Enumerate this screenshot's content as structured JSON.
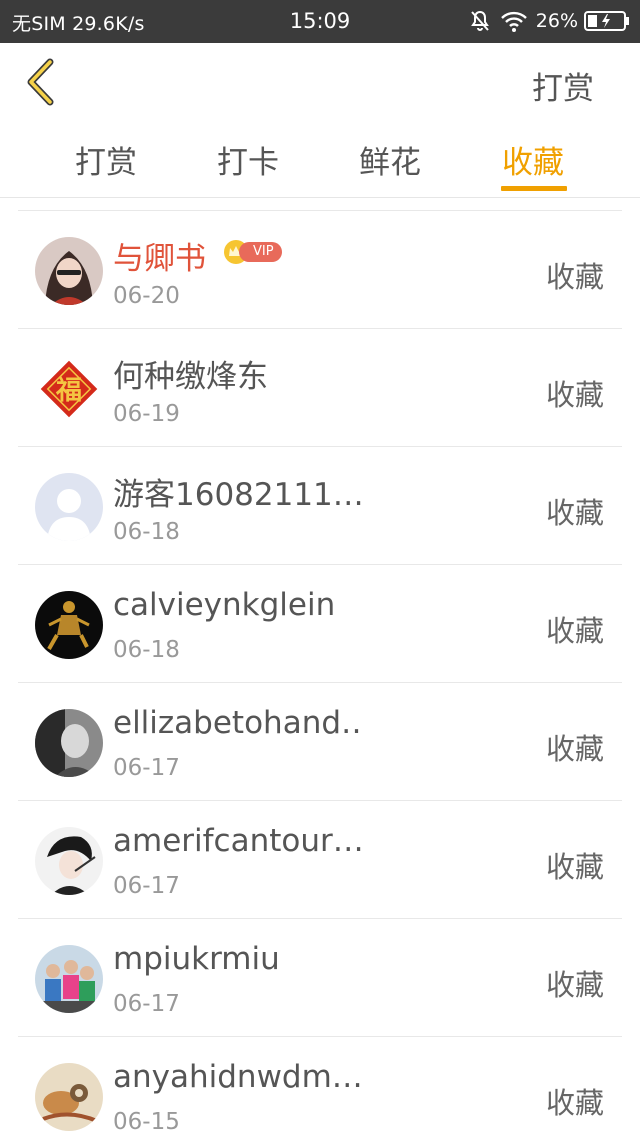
{
  "status_bar": {
    "carrier": "无SIM",
    "speed": "29.6K/s",
    "time": "15:09",
    "battery": "26%"
  },
  "header": {
    "back_icon": "chevron-left-icon",
    "action_label": "打赏"
  },
  "tabs": [
    {
      "label": "打赏",
      "active": false
    },
    {
      "label": "打卡",
      "active": false
    },
    {
      "label": "鲜花",
      "active": false
    },
    {
      "label": "收藏",
      "active": true
    }
  ],
  "colors": {
    "accent": "#f0a000",
    "highlight_name": "#e0533a",
    "status_bar_bg": "#3b3b3b"
  },
  "list": [
    {
      "name": "与卿书",
      "date": "06-20",
      "action": "收藏",
      "vip": "VIP",
      "avatar_icon": "avatar-photo-icon"
    },
    {
      "name": "何种缴烽东",
      "date": "06-19",
      "action": "收藏",
      "avatar_icon": "fu-character-icon"
    },
    {
      "name": "游客16082111…",
      "date": "06-18",
      "action": "收藏",
      "avatar_icon": "default-user-icon"
    },
    {
      "name": "calvieynkglein",
      "date": "06-18",
      "action": "收藏",
      "avatar_icon": "avatar-photo-icon"
    },
    {
      "name": "ellizabetohand…",
      "date": "06-17",
      "action": "收藏",
      "avatar_icon": "avatar-photo-icon"
    },
    {
      "name": "amerifcantour…",
      "date": "06-17",
      "action": "收藏",
      "avatar_icon": "avatar-photo-icon"
    },
    {
      "name": "mpiukrmiu",
      "date": "06-17",
      "action": "收藏",
      "avatar_icon": "avatar-photo-icon"
    },
    {
      "name": "anyahidnwdm…",
      "date": "06-15",
      "action": "收藏",
      "avatar_icon": "avatar-photo-icon"
    }
  ]
}
